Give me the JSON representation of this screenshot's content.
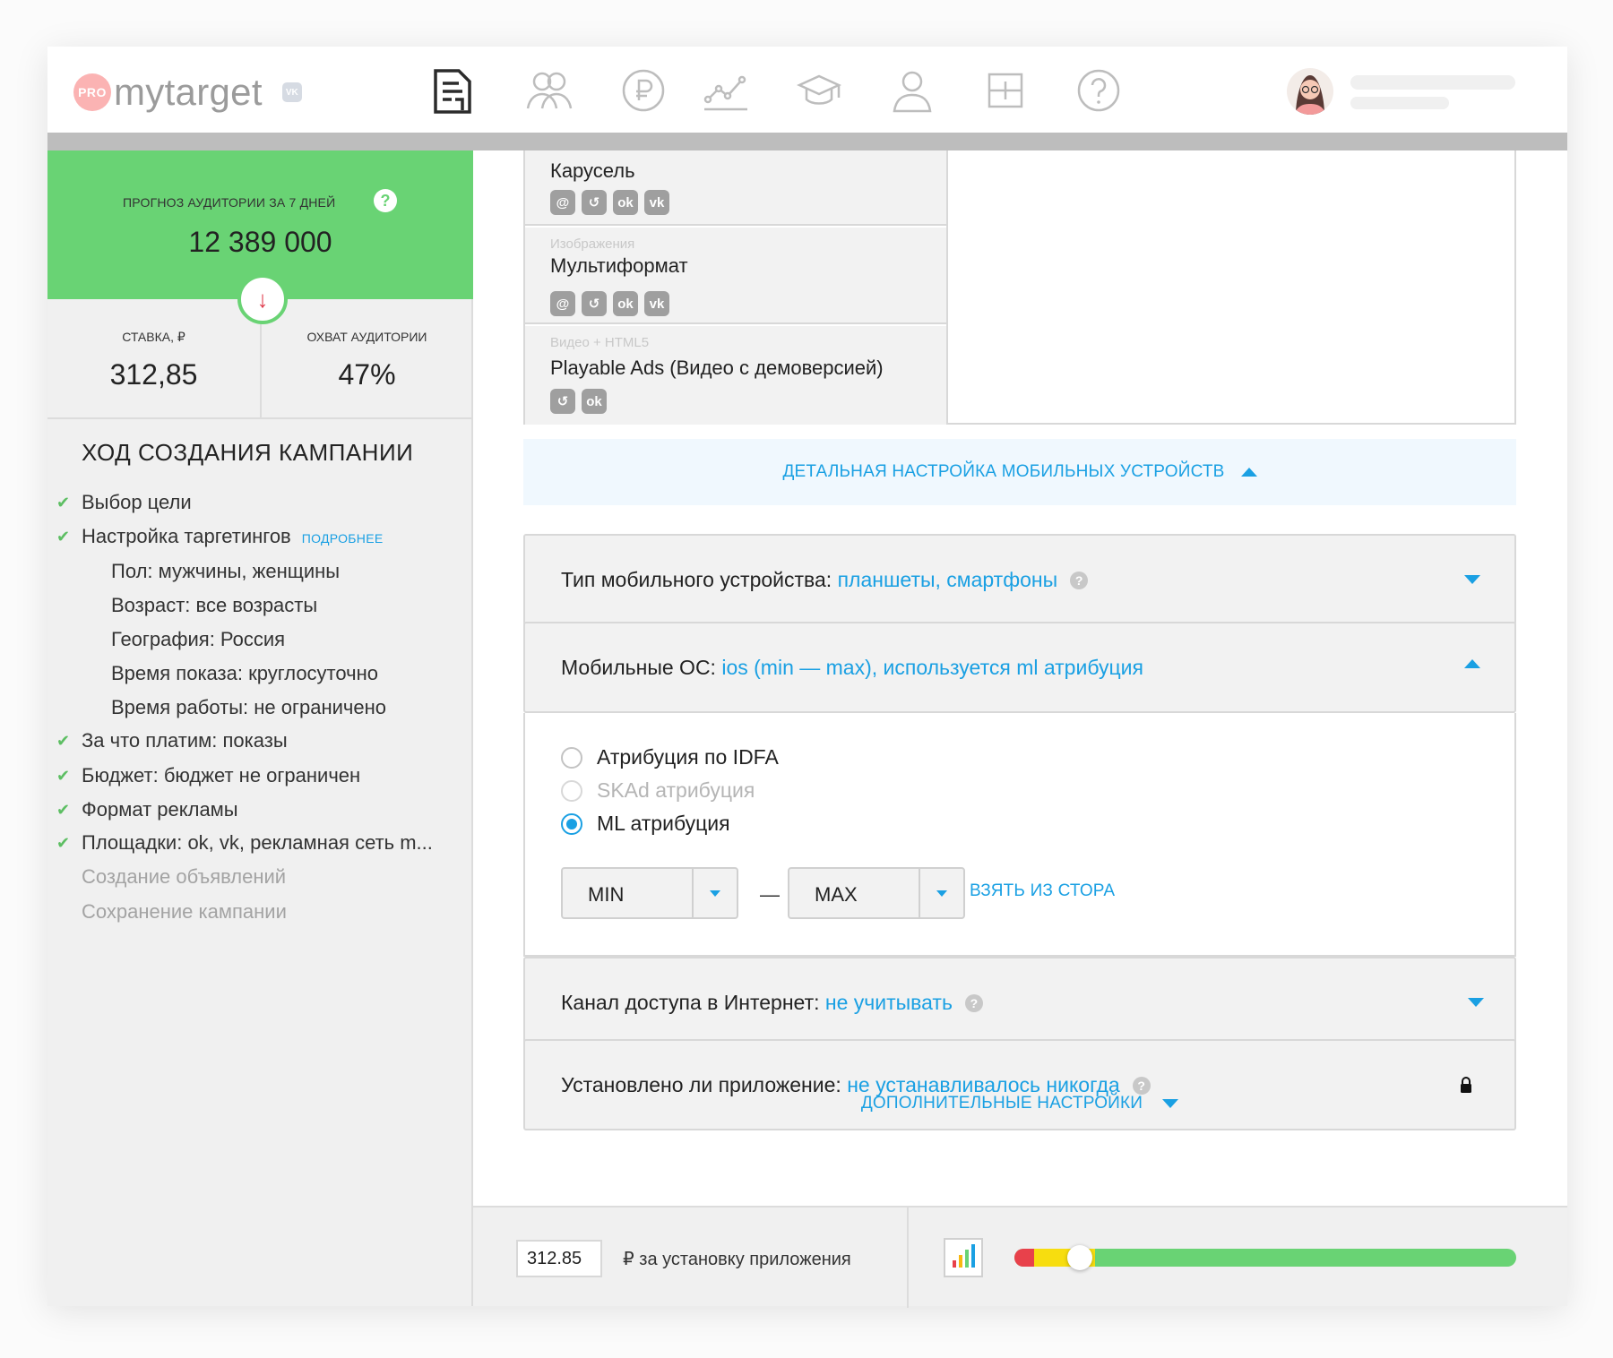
{
  "header": {
    "logo_pro": "PRO",
    "logo_brand": "mytarget",
    "logo_badge": "VK",
    "nav": [
      {
        "icon": "campaigns-icon"
      },
      {
        "icon": "audiences-icon"
      },
      {
        "icon": "balance-icon"
      },
      {
        "icon": "statistics-icon"
      },
      {
        "icon": "training-icon"
      },
      {
        "icon": "profile-icon"
      },
      {
        "icon": "tools-icon"
      },
      {
        "icon": "help-icon"
      }
    ]
  },
  "forecast": {
    "label": "ПРОГНОЗ АУДИТОРИИ ЗА 7 ДНЕЙ",
    "help": "?",
    "value": "12 389 000",
    "arrow": "↓",
    "bid_label": "СТАВКА, ₽",
    "bid_value": "312,85",
    "reach_label": "ОХВАТ АУДИТОРИИ",
    "reach_value": "47%"
  },
  "progress": {
    "title": "ХОД СОЗДАНИЯ КАМПАНИИ",
    "more_link": "ПОДРОБНЕЕ",
    "steps": [
      {
        "label": "Выбор цели"
      },
      {
        "label": "Настройка таргетингов"
      },
      {
        "label": "Пол: мужчины, женщины"
      },
      {
        "label": "Возраст: все возрасты"
      },
      {
        "label": "География: Россия"
      },
      {
        "label": "Время показа: круглосуточно"
      },
      {
        "label": "Время работы: не ограничено"
      },
      {
        "label": "За что платим: показы"
      },
      {
        "label": "Бюджет: бюджет не ограничен"
      },
      {
        "label": "Формат рекламы"
      },
      {
        "label": "Площадки: ok, vk, рекламная сеть m..."
      },
      {
        "label": "Создание объявлений"
      },
      {
        "label": "Сохранение кампании"
      }
    ]
  },
  "formats": [
    {
      "category": "",
      "name": "Карусель",
      "chips": [
        "@",
        "↺",
        "ok",
        "vk"
      ]
    },
    {
      "category": "Изображения",
      "name": "Мультиформат",
      "chips": [
        "@",
        "↺",
        "ok",
        "vk"
      ]
    },
    {
      "category": "Видео + HTML5",
      "name": "Playable Ads (Видео с демоверсией)",
      "chips": [
        "↺",
        "ok"
      ]
    }
  ],
  "detail_link": "ДЕТАЛЬНАЯ НАСТРОЙКА МОБИЛЬНЫХ УСТРОЙСТВ",
  "device": {
    "label": "Тип мобильного устройства:",
    "value": "планшеты, смартфоны"
  },
  "os": {
    "label": "Мобильные ОС:",
    "value": "ios (min — max), используется ml атрибуция"
  },
  "attribution": {
    "options": [
      {
        "label": "Атрибуция по IDFA",
        "state": "unchecked"
      },
      {
        "label": "SKAd атрибуция",
        "state": "disabled"
      },
      {
        "label": "ML атрибуция",
        "state": "checked"
      }
    ],
    "min": "MIN",
    "dash": "—",
    "max": "MAX",
    "store_link": "ВЗЯТЬ ИЗ СТОРА"
  },
  "channel": {
    "label": "Канал доступа в Интернет:",
    "value": "не учитывать"
  },
  "installed": {
    "label": "Установлено ли приложение:",
    "value": "не устанавливалось никогда"
  },
  "extra_link": "ДОПОЛНИТЕЛЬНЫЕ НАСТРОЙКИ",
  "bottom": {
    "bid_value": "312.85",
    "bid_label": "₽ за установку приложения",
    "slider_fraction": 0.13
  },
  "colors": {
    "accent": "#1aa0e3",
    "green": "#69d374",
    "red": "#e8414b",
    "yellow": "#f7dd0f"
  }
}
